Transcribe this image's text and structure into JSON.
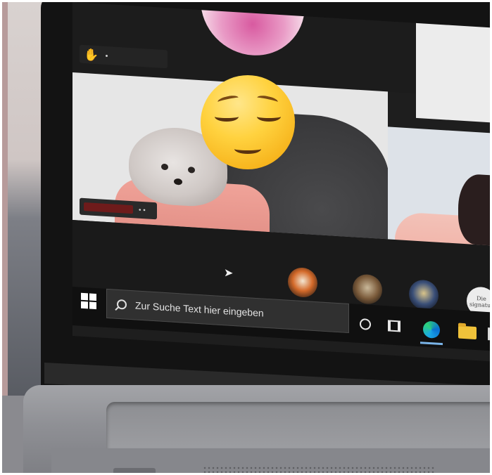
{
  "meeting": {
    "raised_hand_icon": "raised-hand-emoji",
    "hand_glyph": "✋",
    "main_tile_name_dots": "• •",
    "face_cover": "relieved-face-emoji",
    "participant_4_text": "Die\nsignatur"
  },
  "taskbar": {
    "search_placeholder": "Zur Suche Text hier eingeben",
    "icons": [
      "windows-start-icon",
      "search-icon",
      "cortana-icon",
      "task-view-icon",
      "edge-icon",
      "file-explorer-icon"
    ]
  },
  "colors": {
    "taskbar_bg": "#101010",
    "search_bg": "#303030",
    "edge_accent": "#1aa7e6",
    "folder": "#f0c23a"
  }
}
